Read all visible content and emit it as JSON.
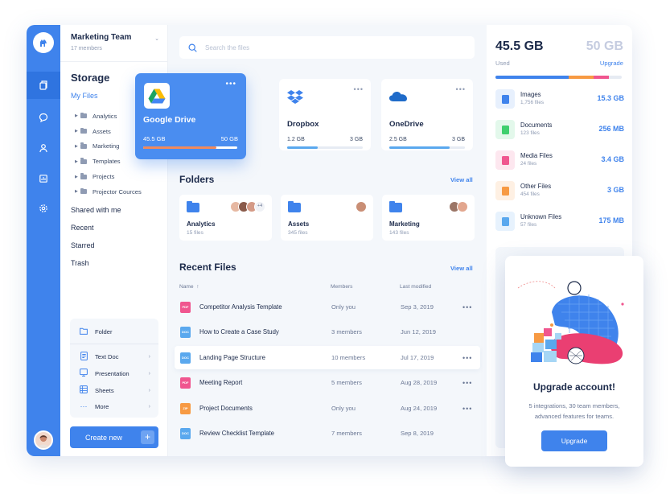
{
  "sidebar": {
    "team_name": "Marketing Team",
    "team_members": "17 members",
    "storage_title": "Storage",
    "my_files": "My Files",
    "tree": [
      "Analytics",
      "Assets",
      "Marketing",
      "Templates",
      "Projects",
      "Projector Cources"
    ],
    "links": [
      "Shared with me",
      "Recent",
      "Starred",
      "Trash"
    ],
    "new_items": {
      "folder": "Folder",
      "text_doc": "Text Doc",
      "presentation": "Presentation",
      "sheets": "Sheets",
      "more": "More"
    },
    "create_new": "Create new",
    "plus": "+"
  },
  "search": {
    "placeholder": "Search the files"
  },
  "drives": [
    {
      "name": "Google Drive",
      "used": "45.5 GB",
      "total": "50 GB",
      "usage_fraction": 0.78,
      "icon": "google-drive-icon"
    },
    {
      "name": "Dropbox",
      "used": "1.2 GB",
      "total": "3 GB",
      "usage_fraction": 0.4,
      "icon": "dropbox-icon"
    },
    {
      "name": "OneDrive",
      "used": "2.5 GB",
      "total": "3 GB",
      "usage_fraction": 0.8,
      "icon": "onedrive-icon"
    }
  ],
  "card_menu": "•••",
  "folders": {
    "title": "Folders",
    "view_all": "View all",
    "items": [
      {
        "name": "Analytics",
        "count": "15 files",
        "extra": "+4"
      },
      {
        "name": "Assets",
        "count": "345 files"
      },
      {
        "name": "Marketing",
        "count": "143 files"
      }
    ]
  },
  "recent": {
    "title": "Recent Files",
    "view_all": "View all",
    "columns": {
      "name": "Name",
      "sort_arrow": "↑",
      "members": "Members",
      "modified": "Last modified"
    },
    "rows": [
      {
        "type": "PDF",
        "color": "#f0568f",
        "name": "Competitor Analysis Template",
        "members": "Only you",
        "date": "Sep 3, 2019"
      },
      {
        "type": "DOC",
        "color": "#5aa8ee",
        "name": "How to Create a Case Study",
        "members": "3 members",
        "date": "Jun 12, 2019"
      },
      {
        "type": "DOC",
        "color": "#5aa8ee",
        "name": "Landing Page Structure",
        "members": "10 members",
        "date": "Jul 17, 2019"
      },
      {
        "type": "PDF",
        "color": "#f0568f",
        "name": "Meeting Report",
        "members": "5 members",
        "date": "Aug 28, 2019"
      },
      {
        "type": "ZIP",
        "color": "#f79a43",
        "name": "Project Documents",
        "members": "Only you",
        "date": "Aug 24, 2019"
      },
      {
        "type": "DOC",
        "color": "#5aa8ee",
        "name": "Review Checklist Template",
        "members": "7 members",
        "date": "Sep 8, 2019"
      }
    ]
  },
  "usage": {
    "used": "45.5 GB",
    "total": "50 GB",
    "used_label": "Used",
    "upgrade_label": "Upgrade",
    "segments": [
      {
        "color": "#3f83ec",
        "fraction": 0.58
      },
      {
        "color": "#f79a43",
        "fraction": 0.2
      },
      {
        "color": "#f0568f",
        "fraction": 0.12
      }
    ],
    "categories": [
      {
        "name": "Images",
        "count": "1,756 files",
        "size": "15.3 GB",
        "icon": "image-icon",
        "color": "#3f83ec",
        "bg": "#e7f0fd"
      },
      {
        "name": "Documents",
        "count": "123 files",
        "size": "256 MB",
        "icon": "document-icon",
        "color": "#3ecf6d",
        "bg": "#e3f8eb"
      },
      {
        "name": "Media Files",
        "count": "24 files",
        "size": "3.4 GB",
        "icon": "media-icon",
        "color": "#f0568f",
        "bg": "#fde7ef"
      },
      {
        "name": "Other Files",
        "count": "454 files",
        "size": "3 GB",
        "icon": "file-icon",
        "color": "#f79a43",
        "bg": "#fef0e3"
      },
      {
        "name": "Unknown Files",
        "count": "57 files",
        "size": "175 MB",
        "icon": "unknown-file-icon",
        "color": "#5aa8ee",
        "bg": "#e7f2fd"
      }
    ]
  },
  "upgrade": {
    "title": "Upgrade account!",
    "line1": "5 integrations, 30 team members,",
    "line2": "advanced features for teams.",
    "button": "Upgrade"
  }
}
